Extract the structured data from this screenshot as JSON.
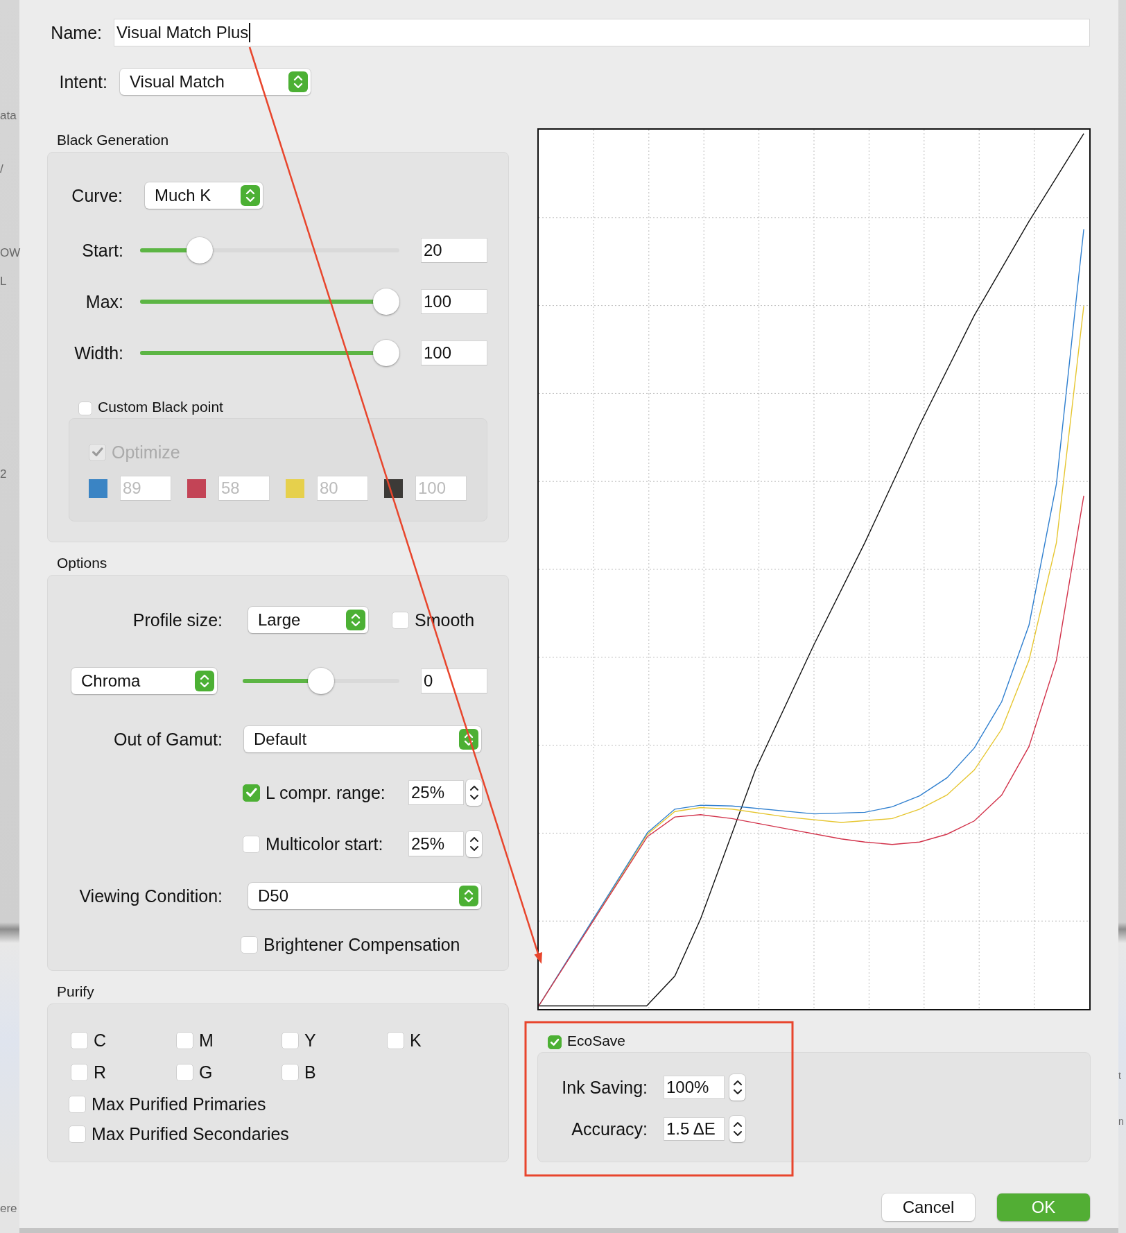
{
  "background_window": {
    "left_fragments": [
      "ata",
      "/",
      "OW",
      "L",
      "2",
      "ere"
    ],
    "right_fragments": [
      "t",
      "n"
    ]
  },
  "name": {
    "label": "Name:",
    "value": "Visual Match Plus"
  },
  "intent": {
    "label": "Intent:",
    "value": "Visual Match"
  },
  "black_generation": {
    "title": "Black Generation",
    "curve": {
      "label": "Curve:",
      "value": "Much K"
    },
    "sliders": [
      {
        "label": "Start:",
        "level": 0.2,
        "value": "20"
      },
      {
        "label": "Max:",
        "level": 1,
        "value": "100"
      },
      {
        "label": "Width:",
        "level": 1,
        "value": "100"
      }
    ],
    "custom_black_point": {
      "label": "Custom Black point",
      "checked": false
    },
    "black_point": {
      "disabled": true,
      "optimize": {
        "label": "Optimize",
        "checked": true
      },
      "inks": [
        {
          "color": "#3a84c4",
          "value": "89"
        },
        {
          "color": "#c34456",
          "value": "58"
        },
        {
          "color": "#e6d04c",
          "value": "80"
        },
        {
          "color": "#3c3a37",
          "value": "100"
        }
      ]
    }
  },
  "options": {
    "title": "Options",
    "profile_size": {
      "label": "Profile size:",
      "value": "Large"
    },
    "smooth": {
      "label": "Smooth",
      "checked": false
    },
    "chroma": {
      "value": "Chroma",
      "level": 0.5,
      "field": "0"
    },
    "out_of_gamut": {
      "label": "Out of Gamut:",
      "value": "Default"
    },
    "l_compr": {
      "label": "L compr. range:",
      "checked": true,
      "value": "25%"
    },
    "multicolor": {
      "label": "Multicolor start:",
      "checked": false,
      "value": "25%"
    },
    "viewing_condition": {
      "label": "Viewing Condition:",
      "value": "D50"
    },
    "brightener": {
      "label": "Brightener Compensation",
      "checked": false
    }
  },
  "purify": {
    "title": "Purify",
    "channels": [
      {
        "label": "C",
        "checked": false
      },
      {
        "label": "M",
        "checked": false
      },
      {
        "label": "Y",
        "checked": false
      },
      {
        "label": "K",
        "checked": false
      },
      {
        "label": "R",
        "checked": false
      },
      {
        "label": "G",
        "checked": false
      },
      {
        "label": "B",
        "checked": false
      }
    ],
    "options": [
      {
        "label": "Max Purified Primaries",
        "checked": false
      },
      {
        "label": "Max Purified Secondaries",
        "checked": false
      }
    ]
  },
  "ecosave": {
    "label": "EcoSave",
    "checked": true,
    "fields": [
      {
        "label": "Ink Saving:",
        "value": "100%"
      },
      {
        "label": "Accuracy:",
        "value": "1.5 ΔE"
      }
    ]
  },
  "buttons": [
    {
      "label": "Cancel",
      "kind": "default"
    },
    {
      "label": "OK",
      "kind": "primary"
    }
  ]
}
